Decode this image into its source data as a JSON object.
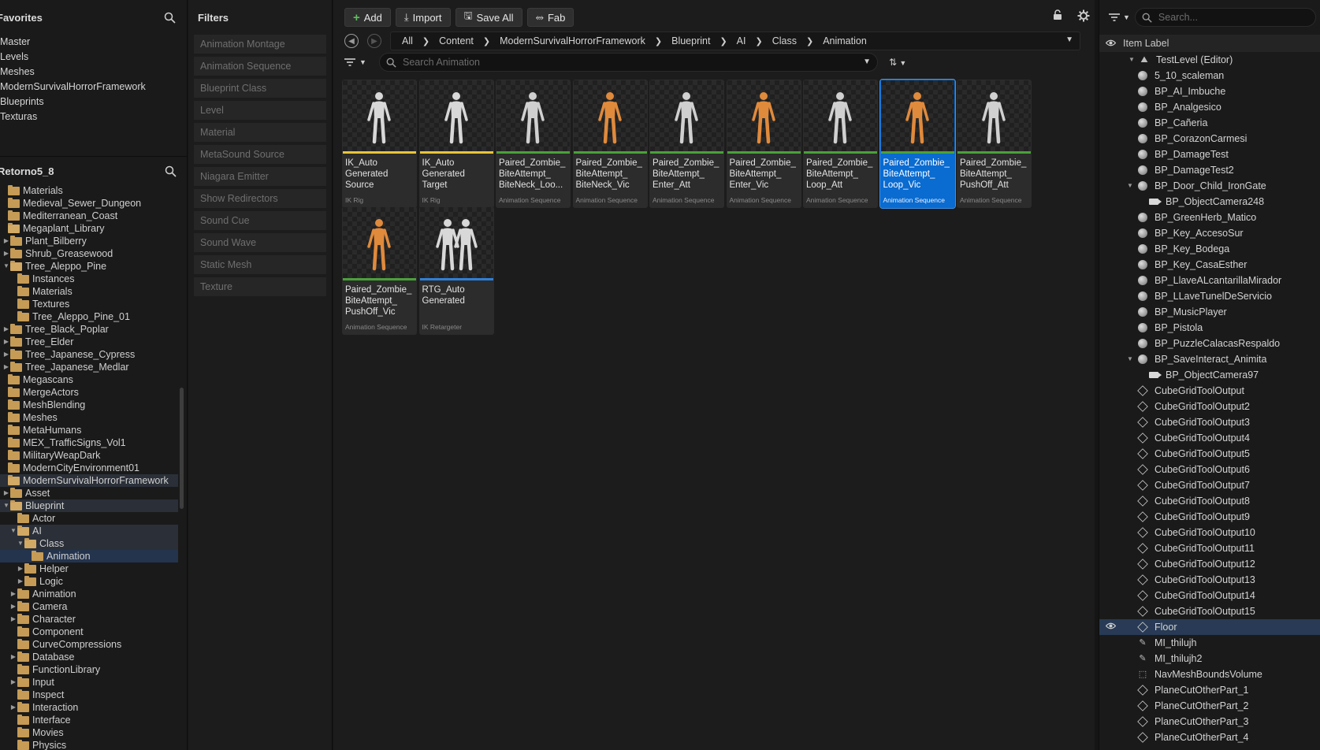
{
  "favorites": {
    "title": "Favorites",
    "items": [
      "Master",
      "Levels",
      "Meshes",
      "ModernSurvivalHorrorFramework",
      "Blueprints",
      "Texturas"
    ]
  },
  "project": {
    "title": "Retorno5_8",
    "tree": [
      {
        "label": "Materials",
        "depth": 0,
        "arrow": "",
        "open": false
      },
      {
        "label": "Medieval_Sewer_Dungeon",
        "depth": 0,
        "arrow": "",
        "open": false
      },
      {
        "label": "Mediterranean_Coast",
        "depth": 0,
        "arrow": "",
        "open": false
      },
      {
        "label": "Megaplant_Library",
        "depth": 0,
        "arrow": "",
        "open": true
      },
      {
        "label": "Plant_Bilberry",
        "depth": 1,
        "arrow": "▶",
        "open": false
      },
      {
        "label": "Shrub_Greasewood",
        "depth": 1,
        "arrow": "▶",
        "open": false
      },
      {
        "label": "Tree_Aleppo_Pine",
        "depth": 1,
        "arrow": "▼",
        "open": true
      },
      {
        "label": "Instances",
        "depth": 2,
        "arrow": "",
        "open": false
      },
      {
        "label": "Materials",
        "depth": 2,
        "arrow": "",
        "open": false
      },
      {
        "label": "Textures",
        "depth": 2,
        "arrow": "",
        "open": false
      },
      {
        "label": "Tree_Aleppo_Pine_01",
        "depth": 2,
        "arrow": "",
        "open": false
      },
      {
        "label": "Tree_Black_Poplar",
        "depth": 1,
        "arrow": "▶",
        "open": false
      },
      {
        "label": "Tree_Elder",
        "depth": 1,
        "arrow": "▶",
        "open": false
      },
      {
        "label": "Tree_Japanese_Cypress",
        "depth": 1,
        "arrow": "▶",
        "open": false
      },
      {
        "label": "Tree_Japanese_Medlar",
        "depth": 1,
        "arrow": "▶",
        "open": false
      },
      {
        "label": "Megascans",
        "depth": 0,
        "arrow": "",
        "open": false
      },
      {
        "label": "MergeActors",
        "depth": 0,
        "arrow": "",
        "open": false
      },
      {
        "label": "MeshBlending",
        "depth": 0,
        "arrow": "",
        "open": false
      },
      {
        "label": "Meshes",
        "depth": 0,
        "arrow": "",
        "open": false
      },
      {
        "label": "MetaHumans",
        "depth": 0,
        "arrow": "",
        "open": false
      },
      {
        "label": "MEX_TrafficSigns_Vol1",
        "depth": 0,
        "arrow": "",
        "open": false
      },
      {
        "label": "MilitaryWeapDark",
        "depth": 0,
        "arrow": "",
        "open": false
      },
      {
        "label": "ModernCityEnvironment01",
        "depth": 0,
        "arrow": "",
        "open": false
      },
      {
        "label": "ModernSurvivalHorrorFramework",
        "depth": 0,
        "arrow": "",
        "open": true,
        "sel": "sel2"
      },
      {
        "label": "Asset",
        "depth": 1,
        "arrow": "▶",
        "open": false
      },
      {
        "label": "Blueprint",
        "depth": 1,
        "arrow": "▼",
        "open": true,
        "sel": "sel2"
      },
      {
        "label": "Actor",
        "depth": 2,
        "arrow": "",
        "open": false
      },
      {
        "label": "AI",
        "depth": 2,
        "arrow": "▼",
        "open": true,
        "sel": "sel2"
      },
      {
        "label": "Class",
        "depth": 3,
        "arrow": "▼",
        "open": true,
        "sel": "sel2"
      },
      {
        "label": "Animation",
        "depth": 4,
        "arrow": "",
        "open": false,
        "sel": "sel"
      },
      {
        "label": "Helper",
        "depth": 3,
        "arrow": "▶",
        "open": false
      },
      {
        "label": "Logic",
        "depth": 3,
        "arrow": "▶",
        "open": false
      },
      {
        "label": "Animation",
        "depth": 2,
        "arrow": "▶",
        "open": false
      },
      {
        "label": "Camera",
        "depth": 2,
        "arrow": "▶",
        "open": false
      },
      {
        "label": "Character",
        "depth": 2,
        "arrow": "▶",
        "open": false
      },
      {
        "label": "Component",
        "depth": 2,
        "arrow": "",
        "open": false
      },
      {
        "label": "CurveCompressions",
        "depth": 2,
        "arrow": "",
        "open": false
      },
      {
        "label": "Database",
        "depth": 2,
        "arrow": "▶",
        "open": false
      },
      {
        "label": "FunctionLibrary",
        "depth": 2,
        "arrow": "",
        "open": false
      },
      {
        "label": "Input",
        "depth": 2,
        "arrow": "▶",
        "open": false
      },
      {
        "label": "Inspect",
        "depth": 2,
        "arrow": "",
        "open": false
      },
      {
        "label": "Interaction",
        "depth": 2,
        "arrow": "▶",
        "open": false
      },
      {
        "label": "Interface",
        "depth": 2,
        "arrow": "",
        "open": false
      },
      {
        "label": "Movies",
        "depth": 2,
        "arrow": "",
        "open": false
      },
      {
        "label": "Physics",
        "depth": 2,
        "arrow": "",
        "open": false
      }
    ]
  },
  "filters": {
    "title": "Filters",
    "items": [
      "Animation Montage",
      "Animation Sequence",
      "Blueprint Class",
      "Level",
      "Material",
      "MetaSound Source",
      "Niagara Emitter",
      "Show Redirectors",
      "Sound Cue",
      "Sound Wave",
      "Static Mesh",
      "Texture"
    ]
  },
  "toolbar": {
    "add": "Add",
    "import": "Import",
    "save_all": "Save All",
    "fab": "Fab"
  },
  "breadcrumb": [
    "All",
    "Content",
    "ModernSurvivalHorrorFramework",
    "Blueprint",
    "AI",
    "Class",
    "Animation"
  ],
  "search": {
    "placeholder": "Search Animation"
  },
  "assets": [
    {
      "name": "IK_Auto Generated Source",
      "type": "IK Rig",
      "bar": "#e8c43a",
      "fig": "#d8d8d8"
    },
    {
      "name": "IK_Auto Generated Target",
      "type": "IK Rig",
      "bar": "#e8c43a",
      "fig": "#d8d8d8"
    },
    {
      "name": "Paired_Zombie_ BiteAttempt_ BiteNeck_Loo...",
      "type": "Animation Sequence",
      "bar": "#4aa13a",
      "fig": "#d0d0d0"
    },
    {
      "name": "Paired_Zombie_ BiteAttempt_ BiteNeck_Vic",
      "type": "Animation Sequence",
      "bar": "#4aa13a",
      "fig": "#e08a3c"
    },
    {
      "name": "Paired_Zombie_ BiteAttempt_ Enter_Att",
      "type": "Animation Sequence",
      "bar": "#4aa13a",
      "fig": "#d0d0d0"
    },
    {
      "name": "Paired_Zombie_ BiteAttempt_ Enter_Vic",
      "type": "Animation Sequence",
      "bar": "#4aa13a",
      "fig": "#e08a3c"
    },
    {
      "name": "Paired_Zombie_ BiteAttempt_ Loop_Att",
      "type": "Animation Sequence",
      "bar": "#4aa13a",
      "fig": "#d0d0d0"
    },
    {
      "name": "Paired_Zombie_ BiteAttempt_ Loop_Vic",
      "type": "Animation Sequence",
      "bar": "#4aa13a",
      "fig": "#e08a3c",
      "selected": true
    },
    {
      "name": "Paired_Zombie_ BiteAttempt_ PushOff_Att",
      "type": "Animation Sequence",
      "bar": "#4aa13a",
      "fig": "#d0d0d0"
    },
    {
      "name": "Paired_Zombie_ BiteAttempt_ PushOff_Vic",
      "type": "Animation Sequence",
      "bar": "#4aa13a",
      "fig": "#e08a3c"
    },
    {
      "name": "RTG_Auto Generated",
      "type": "IK Retargeter",
      "bar": "#2f7fd8",
      "fig": "#d8d8d8",
      "double": true
    }
  ],
  "outliner": {
    "search_placeholder": "Search...",
    "column_label": "Item Label",
    "items": [
      {
        "label": "TestLevel (Editor)",
        "depth": 0,
        "icon": "level",
        "arrow": "▼"
      },
      {
        "label": "5_10_scaleman",
        "depth": 1,
        "icon": "ball"
      },
      {
        "label": "BP_AI_Imbuche",
        "depth": 1,
        "icon": "ball"
      },
      {
        "label": "BP_Analgesico",
        "depth": 1,
        "icon": "ball"
      },
      {
        "label": "BP_Cañeria",
        "depth": 1,
        "icon": "ball"
      },
      {
        "label": "BP_CorazonCarmesi",
        "depth": 1,
        "icon": "ball"
      },
      {
        "label": "BP_DamageTest",
        "depth": 1,
        "icon": "ball"
      },
      {
        "label": "BP_DamageTest2",
        "depth": 1,
        "icon": "ball"
      },
      {
        "label": "BP_Door_Child_IronGate",
        "depth": 1,
        "icon": "ball",
        "arrow": "▼"
      },
      {
        "label": "BP_ObjectCamera248",
        "depth": 2,
        "icon": "cam"
      },
      {
        "label": "BP_GreenHerb_Matico",
        "depth": 1,
        "icon": "ball"
      },
      {
        "label": "BP_Key_AccesoSur",
        "depth": 1,
        "icon": "ball"
      },
      {
        "label": "BP_Key_Bodega",
        "depth": 1,
        "icon": "ball"
      },
      {
        "label": "BP_Key_CasaEsther",
        "depth": 1,
        "icon": "ball"
      },
      {
        "label": "BP_LlaveALcantarillaMirador",
        "depth": 1,
        "icon": "ball"
      },
      {
        "label": "BP_LLaveTunelDeServicio",
        "depth": 1,
        "icon": "ball"
      },
      {
        "label": "BP_MusicPlayer",
        "depth": 1,
        "icon": "ball"
      },
      {
        "label": "BP_Pistola",
        "depth": 1,
        "icon": "ball"
      },
      {
        "label": "BP_PuzzleCalacasRespaldo",
        "depth": 1,
        "icon": "ball"
      },
      {
        "label": "BP_SaveInteract_Animita",
        "depth": 1,
        "icon": "ball",
        "arrow": "▼"
      },
      {
        "label": "BP_ObjectCamera97",
        "depth": 2,
        "icon": "cam"
      },
      {
        "label": "CubeGridToolOutput",
        "depth": 1,
        "icon": "cube"
      },
      {
        "label": "CubeGridToolOutput2",
        "depth": 1,
        "icon": "cube"
      },
      {
        "label": "CubeGridToolOutput3",
        "depth": 1,
        "icon": "cube"
      },
      {
        "label": "CubeGridToolOutput4",
        "depth": 1,
        "icon": "cube"
      },
      {
        "label": "CubeGridToolOutput5",
        "depth": 1,
        "icon": "cube"
      },
      {
        "label": "CubeGridToolOutput6",
        "depth": 1,
        "icon": "cube"
      },
      {
        "label": "CubeGridToolOutput7",
        "depth": 1,
        "icon": "cube"
      },
      {
        "label": "CubeGridToolOutput8",
        "depth": 1,
        "icon": "cube"
      },
      {
        "label": "CubeGridToolOutput9",
        "depth": 1,
        "icon": "cube"
      },
      {
        "label": "CubeGridToolOutput10",
        "depth": 1,
        "icon": "cube"
      },
      {
        "label": "CubeGridToolOutput11",
        "depth": 1,
        "icon": "cube"
      },
      {
        "label": "CubeGridToolOutput12",
        "depth": 1,
        "icon": "cube"
      },
      {
        "label": "CubeGridToolOutput13",
        "depth": 1,
        "icon": "cube"
      },
      {
        "label": "CubeGridToolOutput14",
        "depth": 1,
        "icon": "cube"
      },
      {
        "label": "CubeGridToolOutput15",
        "depth": 1,
        "icon": "cube"
      },
      {
        "label": "Floor",
        "depth": 1,
        "icon": "cube",
        "selected": true
      },
      {
        "label": "MI_thilujh",
        "depth": 1,
        "icon": "brush"
      },
      {
        "label": "MI_thilujh2",
        "depth": 1,
        "icon": "brush"
      },
      {
        "label": "NavMeshBoundsVolume",
        "depth": 1,
        "icon": "volume"
      },
      {
        "label": "PlaneCutOtherPart_1",
        "depth": 1,
        "icon": "cube"
      },
      {
        "label": "PlaneCutOtherPart_2",
        "depth": 1,
        "icon": "cube"
      },
      {
        "label": "PlaneCutOtherPart_3",
        "depth": 1,
        "icon": "cube"
      },
      {
        "label": "PlaneCutOtherPart_4",
        "depth": 1,
        "icon": "cube"
      }
    ]
  }
}
